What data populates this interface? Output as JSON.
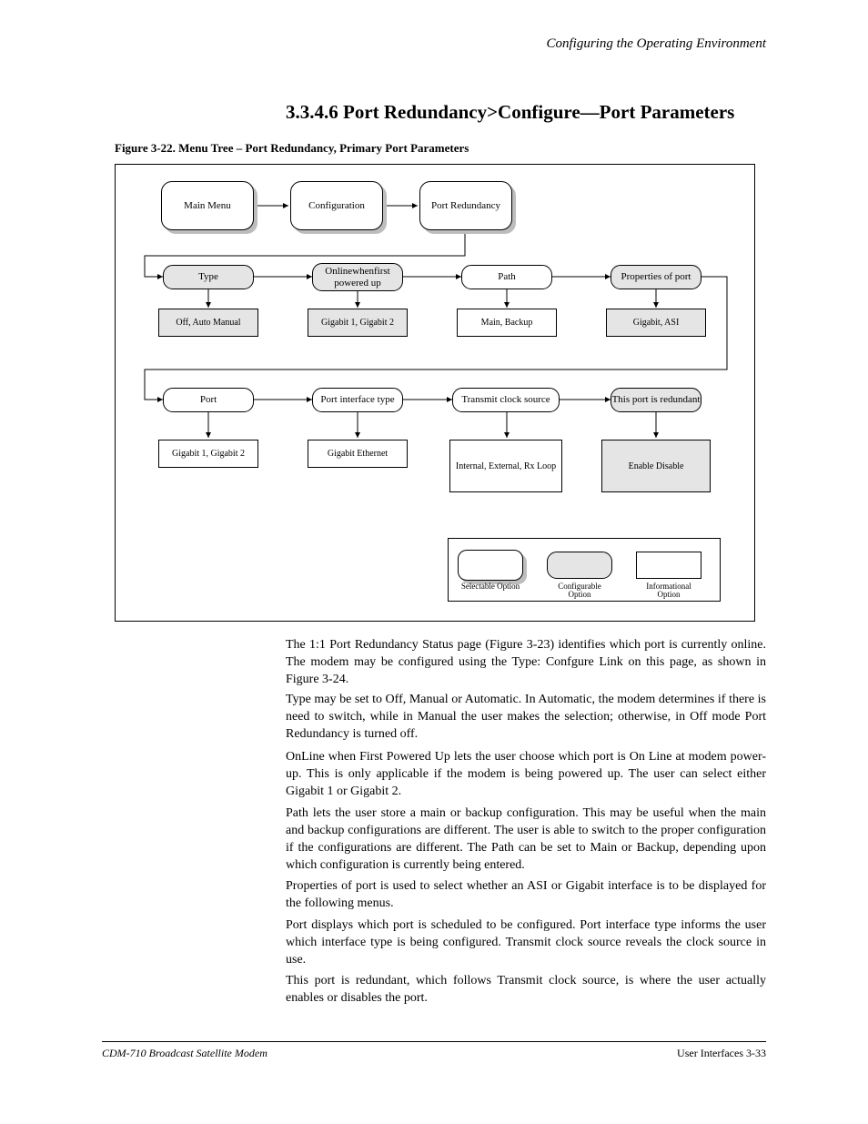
{
  "page": {
    "chapter": "Configuring the Operating Environment",
    "section_title": "3.3.4.6 Port Redundancy>Configure—Port Parameters",
    "figure_title": "Figure 3-22. Menu Tree – Port Redundancy, Primary Port Parameters",
    "footer_left": "CDM-710 Broadcast Satellite Modem",
    "footer_right": "User Interfaces   3-33"
  },
  "flow": {
    "top": [
      "Main Menu",
      "Configuration",
      "Port Redundancy"
    ],
    "row2": {
      "sub": [
        "Type",
        "Onlinewhenfirst powered up",
        "Path",
        "Properties of port"
      ],
      "opt": [
        "Off, Auto Manual",
        "Gigabit 1, Gigabit 2",
        "Main, Backup",
        "Gigabit, ASI"
      ]
    },
    "row3": {
      "sub": [
        "Port",
        "Port interface type",
        "Transmit clock source",
        "This port is redundant"
      ],
      "opt": [
        "Gigabit 1, Gigabit 2",
        "Gigabit Ethernet",
        "Internal, External, Rx Loop",
        "Enable Disable"
      ]
    }
  },
  "legend": {
    "selectable": "Selectable Option",
    "config": "Configurable Option",
    "info": "Informational Option"
  },
  "paras": {
    "p1": "The 1:1 Port Redundancy Status page (Figure 3-23) identifies which port is currently online. The modem may be configured using the Type: Confgure Link on this page, as shown in Figure 3-24.",
    "p2": "Type may be set to Off, Manual or Automatic. In Automatic, the modem determines if there is need to switch, while in Manual the user makes the selection; otherwise, in Off mode Port Redundancy is turned off.",
    "p3": "OnLine when First Powered Up lets the user choose which port is On Line at modem power-up. This is only applicable if the modem is being powered up. The user can select either Gigabit 1 or Gigabit 2.",
    "p4": "Path lets the user store a main or backup configuration. This may be useful when the main and backup configurations are different. The user is able to switch to the proper configuration if the configurations are different. The Path can be set to Main or Backup, depending upon which configuration is currently being entered.",
    "p5": "Properties of port is used to select whether an ASI or Gigabit interface is to be displayed for the following menus.",
    "p6": "Port displays which port is scheduled to be configured. Port interface type informs the user which interface type is being configured. Transmit clock source reveals the clock source in use.",
    "p7": "This port is redundant, which follows Transmit clock source, is where the user actually enables or disables the port."
  }
}
